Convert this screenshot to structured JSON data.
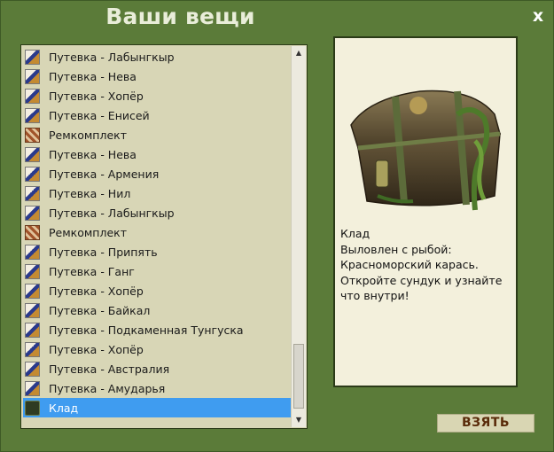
{
  "window": {
    "title": "Ваши вещи",
    "close_label": "x"
  },
  "items": [
    {
      "label": "Путевка - Лабынгкыр",
      "icon": "ticket-icon"
    },
    {
      "label": "Путевка - Нева",
      "icon": "ticket-icon"
    },
    {
      "label": "Путевка - Хопёр",
      "icon": "ticket-icon"
    },
    {
      "label": "Путевка - Енисей",
      "icon": "ticket-icon"
    },
    {
      "label": "Ремкомплект",
      "icon": "repair-kit-icon"
    },
    {
      "label": "Путевка - Нева",
      "icon": "ticket-icon"
    },
    {
      "label": "Путевка - Армения",
      "icon": "ticket-icon"
    },
    {
      "label": "Путевка - Нил",
      "icon": "ticket-icon"
    },
    {
      "label": "Путевка - Лабынгкыр",
      "icon": "ticket-icon"
    },
    {
      "label": "Ремкомплект",
      "icon": "repair-kit-icon"
    },
    {
      "label": "Путевка - Припять",
      "icon": "ticket-icon"
    },
    {
      "label": "Путевка - Ганг",
      "icon": "ticket-icon"
    },
    {
      "label": "Путевка - Хопёр",
      "icon": "ticket-icon"
    },
    {
      "label": "Путевка - Байкал",
      "icon": "ticket-icon"
    },
    {
      "label": "Путевка - Подкаменная Тунгуска",
      "icon": "ticket-icon"
    },
    {
      "label": "Путевка - Хопёр",
      "icon": "ticket-icon"
    },
    {
      "label": "Путевка - Австралия",
      "icon": "ticket-icon"
    },
    {
      "label": "Путевка - Амударья",
      "icon": "ticket-icon"
    },
    {
      "label": "Клад",
      "icon": "treasure-chest-icon",
      "selected": true
    }
  ],
  "preview": {
    "image": "treasure-chest-image",
    "lines": [
      "Клад",
      "Выловлен с рыбой:",
      "Красноморский карась.",
      "Откройте сундук и узнайте что внутри!"
    ]
  },
  "actions": {
    "take_label": "ВЗЯТЬ"
  },
  "colors": {
    "background": "#5b7b39",
    "list_background": "#d8d6b6",
    "selection": "#3f9cf0",
    "preview_background": "#f3f0dc",
    "button_text": "#5a2c0a"
  }
}
